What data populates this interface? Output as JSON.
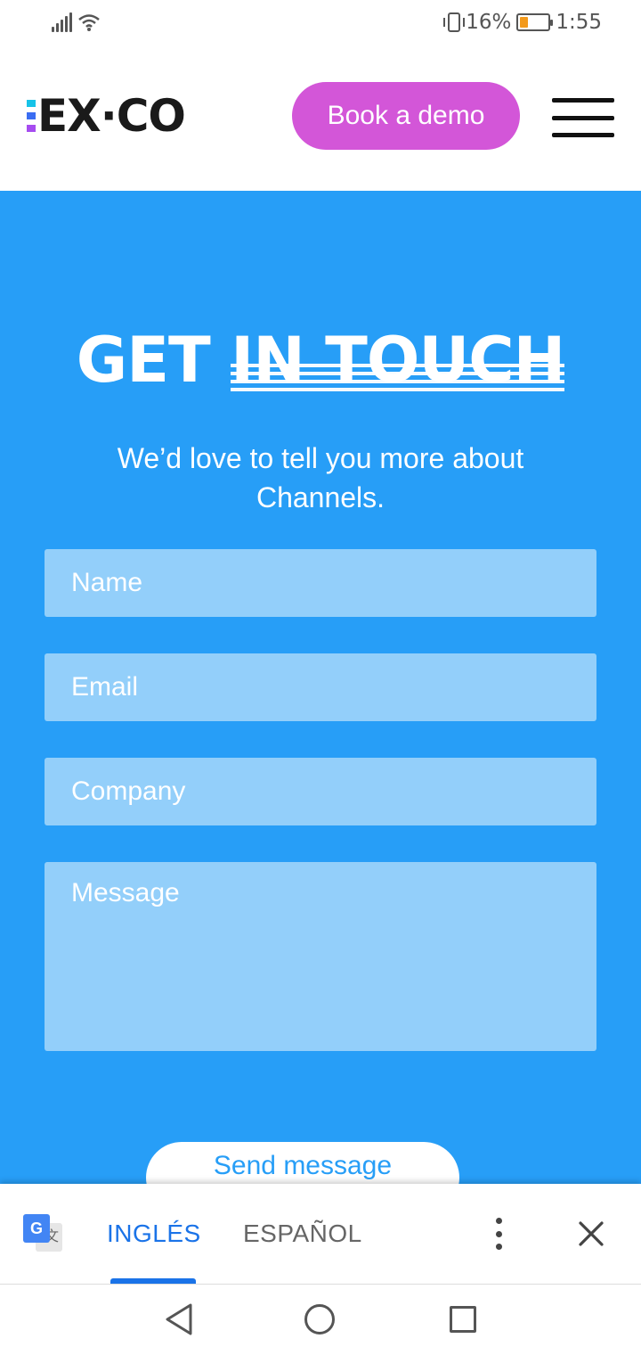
{
  "status_bar": {
    "battery_percent": "16%",
    "time": "1:55",
    "battery_fill_fraction": 0.16,
    "battery_color": "#f39a1c"
  },
  "header": {
    "logo_text": "EX·CO",
    "book_demo_label": "Book a demo",
    "logo_bar_colors": [
      "#17c3e8",
      "#3b6df2",
      "#a64cf0"
    ],
    "book_demo_color": "#d356d8"
  },
  "contact": {
    "title_plain": "GET",
    "title_highlight": "IN TOUCH",
    "subtitle": "We’d love to tell you more about Channels.",
    "section_color": "#279ef7",
    "fields": {
      "name_placeholder": "Name",
      "email_placeholder": "Email",
      "company_placeholder": "Company",
      "message_placeholder": "Message"
    },
    "send_label": "Send message"
  },
  "translate_bar": {
    "source_language": "INGLÉS",
    "target_language": "ESPAÑOL",
    "icons": [
      "google-translate-icon",
      "more-vert-icon",
      "close-icon"
    ]
  },
  "nav_bar": {
    "icons": [
      "back-icon",
      "home-icon",
      "recents-icon"
    ]
  }
}
